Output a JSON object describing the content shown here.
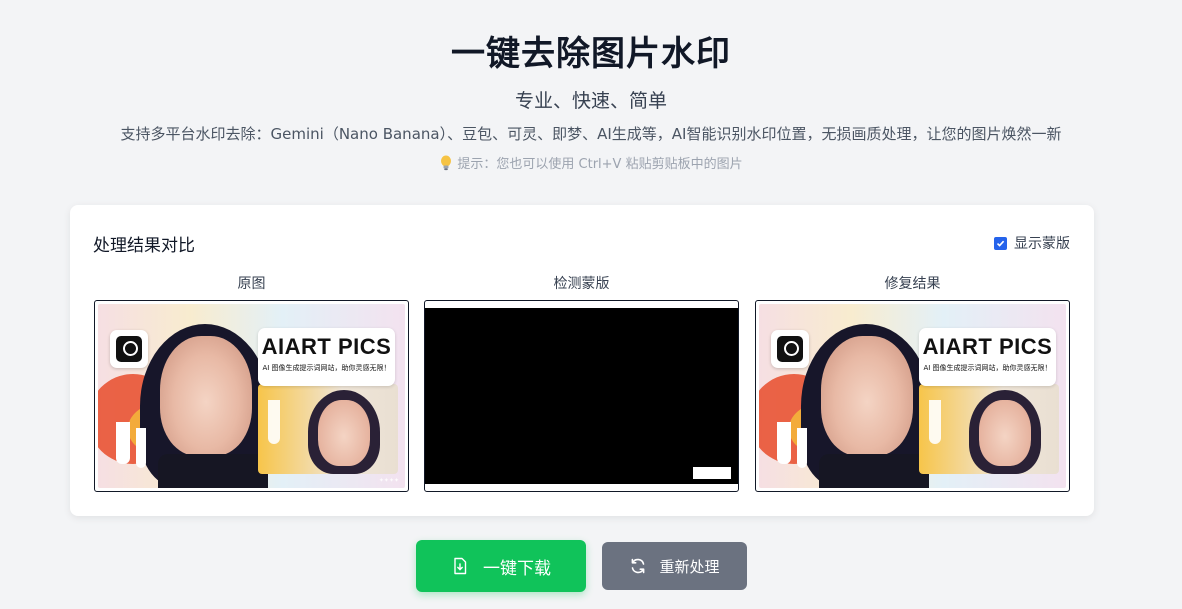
{
  "header": {
    "title": "一键去除图片水印",
    "subtitle": "专业、快速、简单",
    "description": "支持多平台水印去除：Gemini（Nano Banana）、豆包、可灵、即梦、AI生成等，AI智能识别水印位置，无损画质处理，让您的图片焕然一新",
    "tip": "提示：您也可以使用 Ctrl+V 粘贴剪贴板中的图片"
  },
  "result": {
    "title": "处理结果对比",
    "show_mask_label": "显示蒙版",
    "show_mask_checked": true,
    "columns": [
      {
        "label": "原图"
      },
      {
        "label": "检测蒙版"
      },
      {
        "label": "修复结果"
      }
    ],
    "image": {
      "brand_title": "AIART PICS",
      "brand_subtitle": "AI 图像生成提示词网站，助你灵感无限！"
    }
  },
  "actions": {
    "download_label": "一键下载",
    "reprocess_label": "重新处理"
  },
  "colors": {
    "download_button": "#10c35a",
    "reprocess_button": "#6b7280",
    "checkbox": "#2563eb",
    "background": "#f3f4f6"
  },
  "icons": {
    "tip": "lightbulb-icon",
    "download": "file-download-icon",
    "reprocess": "refresh-icon",
    "checkbox": "checkbox-checked-icon"
  }
}
